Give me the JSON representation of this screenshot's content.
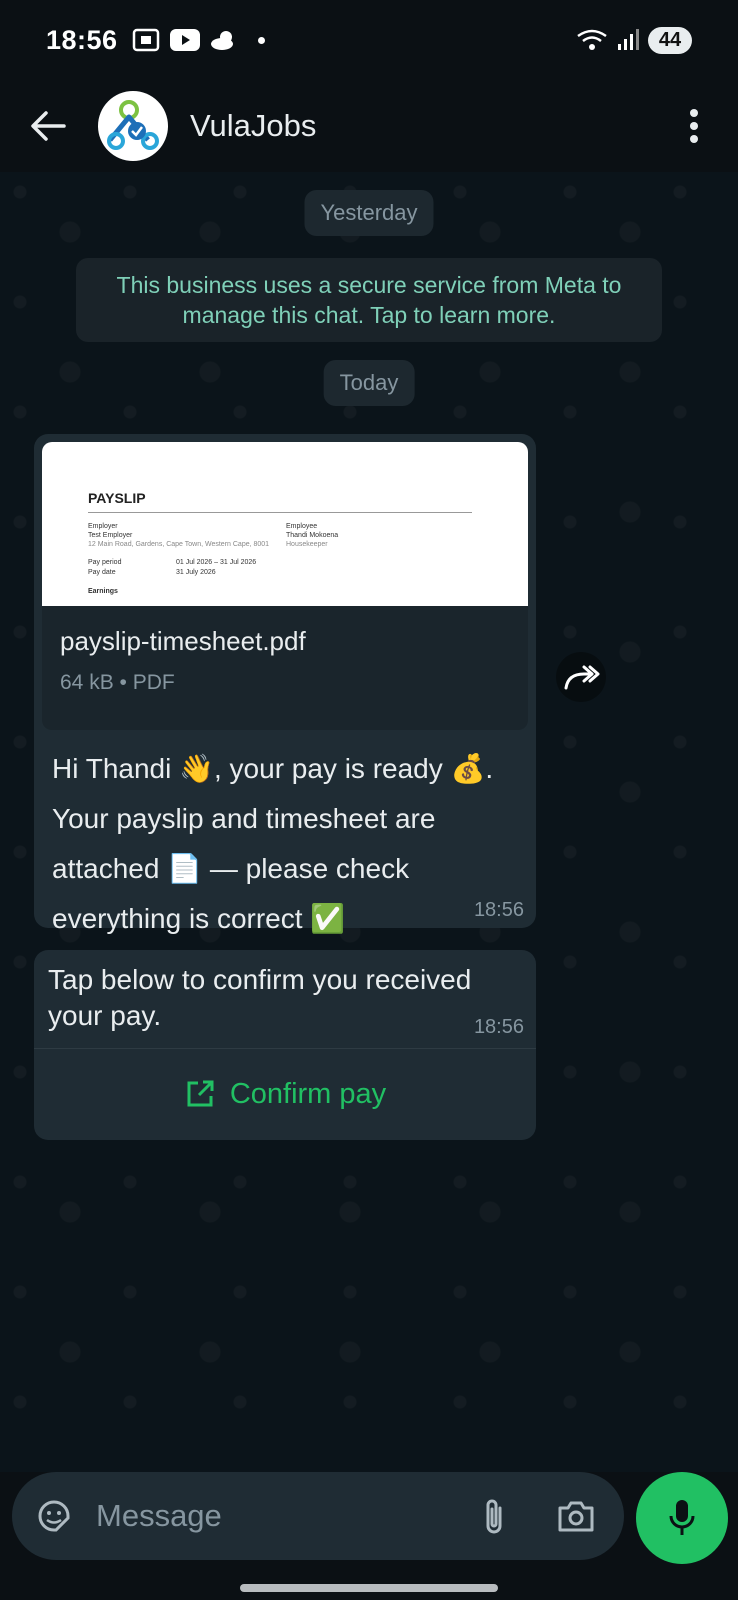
{
  "status_bar": {
    "time": "18:56",
    "battery": "44"
  },
  "header": {
    "title": "VulaJobs"
  },
  "chat": {
    "date_yesterday": "Yesterday",
    "meta_notice": "This business uses a secure service from Meta to manage this chat. Tap to learn more.",
    "date_today": "Today",
    "document": {
      "preview": {
        "title": "PAYSLIP",
        "employer_label": "Employer",
        "employer_name": "Test Employer",
        "employer_address": "12 Main Road, Gardens, Cape Town, Western Cape, 8001",
        "employee_label": "Employee",
        "employee_name": "Thandi Mokoena",
        "employee_role": "Housekeeper",
        "pay_period_label": "Pay period",
        "pay_period_value": "01 Jul 2026 – 31 Jul 2026",
        "pay_date_label": "Pay date",
        "pay_date_value": "31 July 2026",
        "earnings_label": "Earnings"
      },
      "file_name": "payslip-timesheet.pdf",
      "file_meta": "64 kB • PDF"
    },
    "message": {
      "part1": "Hi Thandi ",
      "emoji1": "👋",
      "part2": ", your pay is ready ",
      "emoji2": "💰",
      "part3": ". Your payslip and timesheet are attached ",
      "emoji3": "📄",
      "part4": " — please check everything is correct ",
      "emoji4": "✅",
      "time": "18:56"
    },
    "confirm": {
      "text": "Tap below to confirm you received your pay.",
      "time": "18:56",
      "button_label": "Confirm pay"
    }
  },
  "input": {
    "placeholder": "Message"
  },
  "colors": {
    "accent": "#21c063",
    "bubble": "#1f2c34",
    "notice_text": "#7fd0b8"
  }
}
